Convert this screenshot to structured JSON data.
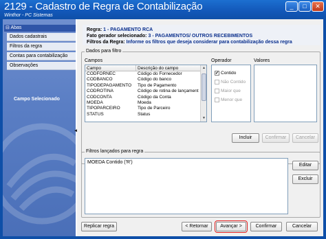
{
  "window": {
    "title": "2129 - Cadastro de Regra de Contabilização",
    "subtitle": "Winthor - PC Sistemas",
    "minimize_glyph": "_",
    "maximize_glyph": "□",
    "close_glyph": "✕"
  },
  "sidebar": {
    "header": "Abas",
    "items": [
      {
        "label": "Dados cadastrais"
      },
      {
        "label": "Filtros da regra"
      },
      {
        "label": "Contas para contabilização"
      },
      {
        "label": "Observações"
      }
    ],
    "section_label": "Campo Selecionado",
    "collapse_glyph": "◀"
  },
  "info": {
    "regra_label": "Regra:",
    "regra_value": "1 - PAGAMENTO RCA",
    "fato_label": "Fato gerador selecionado:",
    "fato_value": "3 - PAGAMENTOS/ OUTROS RECEBIMENTOS",
    "filtros_label": "Filtros da Regra:",
    "filtros_value": "Informe os filtros que deseja considerar para contabilização dessa regra"
  },
  "dados_filtro": {
    "group_label": "Dados para filtro",
    "campos_label": "Campos",
    "operador_label": "Operador",
    "valores_label": "Valores",
    "columns": [
      "Campo",
      "Descrição do campo"
    ],
    "rows": [
      [
        "CODFORNEC",
        "Código do Fornecedor"
      ],
      [
        "CODBANCO",
        "Código do banco"
      ],
      [
        "TIPODEPAGAMENTO",
        "Tipo de Pagamento"
      ],
      [
        "CODROTINA",
        "Código de rotina de lançament"
      ],
      [
        "CODCONTA",
        "Código da Conta"
      ],
      [
        "MOEDA",
        "Moeda"
      ],
      [
        "TIPOPARCEIRO",
        "Tipo de Parceiro"
      ],
      [
        "STATUS",
        "Status"
      ]
    ],
    "operators": [
      {
        "label": "Contido",
        "checked": true,
        "enabled": true
      },
      {
        "label": "Não Contido",
        "checked": false,
        "enabled": false
      },
      {
        "label": "Maior que",
        "checked": false,
        "enabled": false
      },
      {
        "label": "Menor que",
        "checked": false,
        "enabled": false
      }
    ],
    "check_glyph": "✔",
    "buttons": {
      "incluir": "Incluir",
      "confirmar": "Confirmar",
      "cancelar": "Cancelar"
    }
  },
  "filtros_lancados": {
    "group_label": "Filtros lançados para regra",
    "lines": [
      "MOEDA Contido ('R')"
    ],
    "buttons": {
      "editar": "Editar",
      "excluir": "Excluir"
    }
  },
  "footer": {
    "replicar": "Replicar regra",
    "retornar": "< Retornar",
    "avancar": "Avançar >",
    "confirmar": "Confirmar",
    "cancelar": "Cancelar"
  },
  "colors": {
    "titlebar": "#1257b8",
    "highlight": "#e02020",
    "info_blue": "#0a2f8c"
  }
}
